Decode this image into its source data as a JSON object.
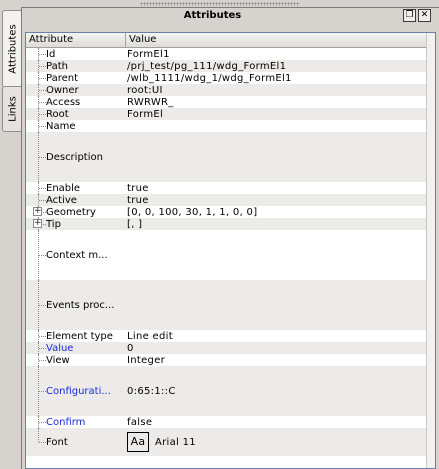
{
  "panel": {
    "title": "Attributes"
  },
  "tabs": [
    {
      "label": "Attributes"
    },
    {
      "label": "Links"
    }
  ],
  "table": {
    "headers": {
      "attribute": "Attribute",
      "value": "Value"
    },
    "rows": [
      {
        "name": "Id",
        "value": "FormEl1"
      },
      {
        "name": "Path",
        "value": "/prj_test/pg_111/wdg_FormEl1"
      },
      {
        "name": "Parent",
        "value": "/wlb_1111/wdg_1/wdg_FormEl1"
      },
      {
        "name": "Owner",
        "value": "root:UI"
      },
      {
        "name": "Access",
        "value": "RWRWR_"
      },
      {
        "name": "Root",
        "value": "FormEl"
      },
      {
        "name": "Name",
        "value": ""
      },
      {
        "name": "Description",
        "value": ""
      },
      {
        "name": "Enable",
        "value": "true"
      },
      {
        "name": "Active",
        "value": "true"
      },
      {
        "name": "Geometry",
        "value": "[0, 0, 100, 30, 1, 1, 0, 0]"
      },
      {
        "name": "Tip",
        "value": "[, ]"
      },
      {
        "name": "Context m...",
        "value": ""
      },
      {
        "name": "Events proc...",
        "value": ""
      },
      {
        "name": "Element type",
        "value": "Line edit"
      },
      {
        "name": "Value",
        "value": "0"
      },
      {
        "name": "View",
        "value": "Integer"
      },
      {
        "name": "Configurati...",
        "value": "0:65:1::C"
      },
      {
        "name": "Confirm",
        "value": "false"
      },
      {
        "name": "Font",
        "value": "Arial 11",
        "preview": "Aa"
      }
    ]
  },
  "colors": {
    "highlight_name": "#1a2bd6",
    "header_border": "#6a7fa6"
  }
}
